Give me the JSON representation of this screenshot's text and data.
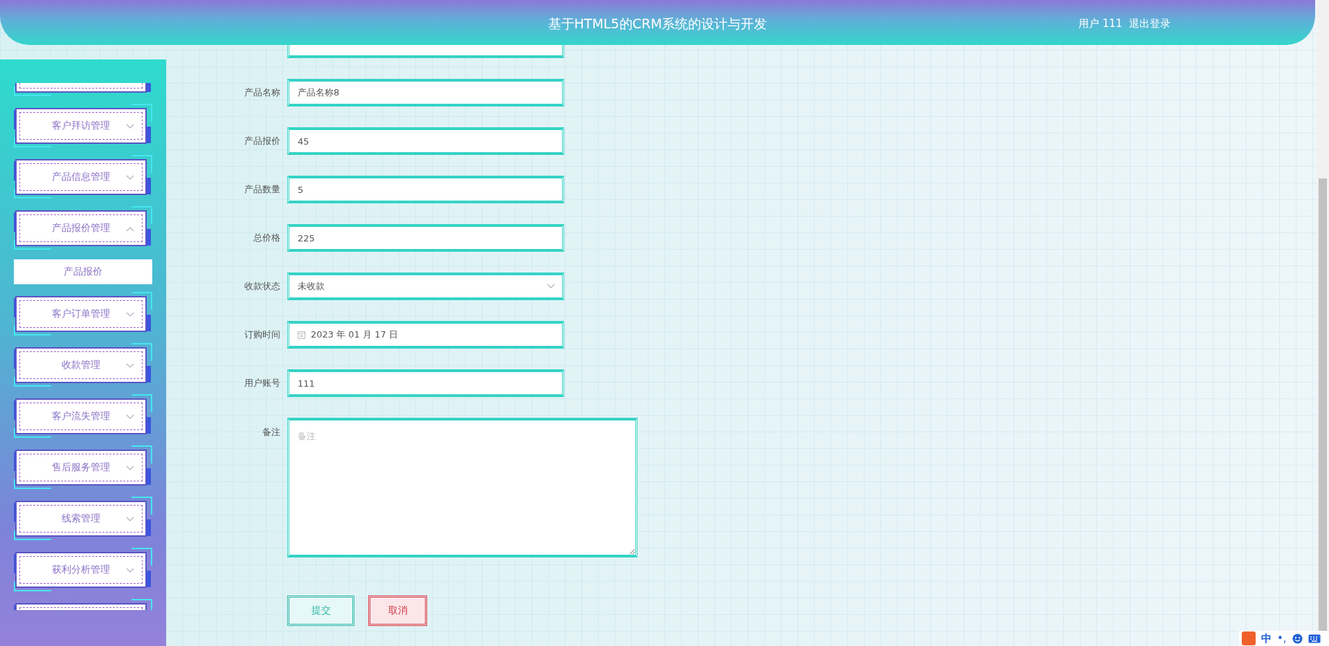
{
  "header": {
    "title": "基于HTML5的CRM系统的设计与开发",
    "user": "用户 111",
    "logout": "退出登录"
  },
  "sidebar": {
    "menu": [
      {
        "label": "客户拜访管理",
        "expanded": false
      },
      {
        "label": "产品信息管理",
        "expanded": false
      },
      {
        "label": "产品报价管理",
        "expanded": true,
        "children": [
          {
            "label": "产品报价"
          }
        ]
      },
      {
        "label": "客户订单管理",
        "expanded": false
      },
      {
        "label": "收款管理",
        "expanded": false
      },
      {
        "label": "客户流失管理",
        "expanded": false
      },
      {
        "label": "售后服务管理",
        "expanded": false
      },
      {
        "label": "线索管理",
        "expanded": false
      },
      {
        "label": "获利分析管理",
        "expanded": false
      }
    ]
  },
  "form": {
    "fields": [
      {
        "label": "产品名称",
        "kind": "text",
        "value": "产品名称8"
      },
      {
        "label": "产品报价",
        "kind": "text",
        "value": "45"
      },
      {
        "label": "产品数量",
        "kind": "text",
        "value": "5"
      },
      {
        "label": "总价格",
        "kind": "text",
        "value": "225"
      },
      {
        "label": "收款状态",
        "kind": "select",
        "value": "未收款"
      },
      {
        "label": "订购时间",
        "kind": "date",
        "value": "2023 年 01 月 17 日"
      },
      {
        "label": "用户账号",
        "kind": "text",
        "value": "111"
      },
      {
        "label": "备注",
        "kind": "textarea",
        "placeholder": "备注"
      }
    ],
    "buttons": [
      {
        "label": "提交",
        "kind": "primary"
      },
      {
        "label": "取消",
        "kind": "danger"
      }
    ]
  },
  "ime_bar": {
    "mode": "中",
    "punctuation": "•,"
  }
}
